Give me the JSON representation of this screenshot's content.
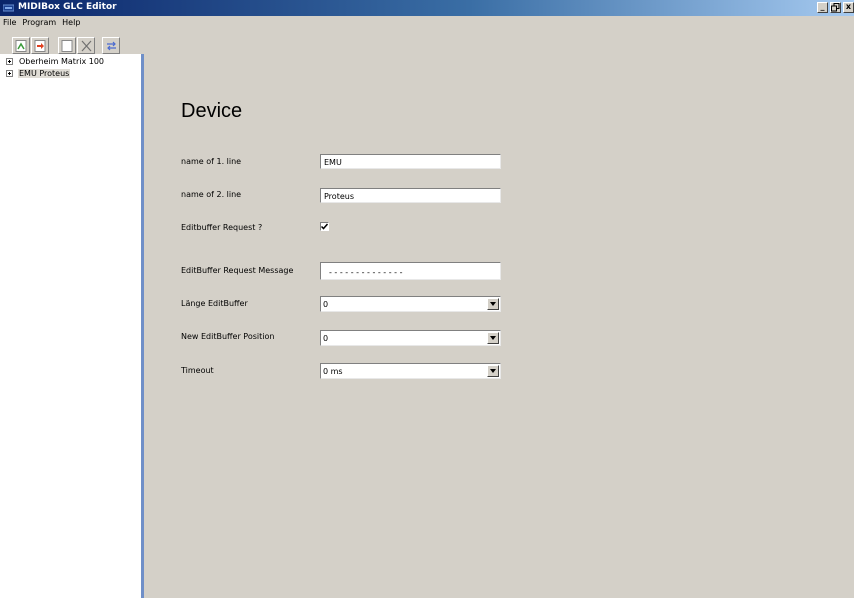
{
  "window": {
    "title": "MIDIBox GLC Editor",
    "minimize": "_",
    "maximize": "§",
    "close": "x"
  },
  "menu": {
    "items": [
      "File",
      "Program",
      "Help"
    ]
  },
  "toolbar": {
    "buttons": [
      "import-icon",
      "export-icon",
      "new-icon",
      "delete-icon",
      "swap-icon"
    ]
  },
  "tree": {
    "items": [
      {
        "label": "Oberheim Matrix 100",
        "selected": false
      },
      {
        "label": "EMU Proteus",
        "selected": true
      }
    ]
  },
  "form": {
    "heading": "Device",
    "line1_label": "name of 1. line",
    "line1_value": "EMU",
    "line2_label": "name of 2. line",
    "line2_value": "Proteus",
    "editbuffer_request_label": "Editbuffer Request ?",
    "editbuffer_request_checked": true,
    "editbuffer_message_label": "EditBuffer Request Message",
    "editbuffer_message_value": "- - - - - - - - - - - - - -",
    "laenge_label": "Länge EditBuffer",
    "laenge_value": "0",
    "position_label": "New EditBuffer Position",
    "position_value": "0",
    "timeout_label": "Timeout",
    "timeout_value": "0 ms"
  }
}
